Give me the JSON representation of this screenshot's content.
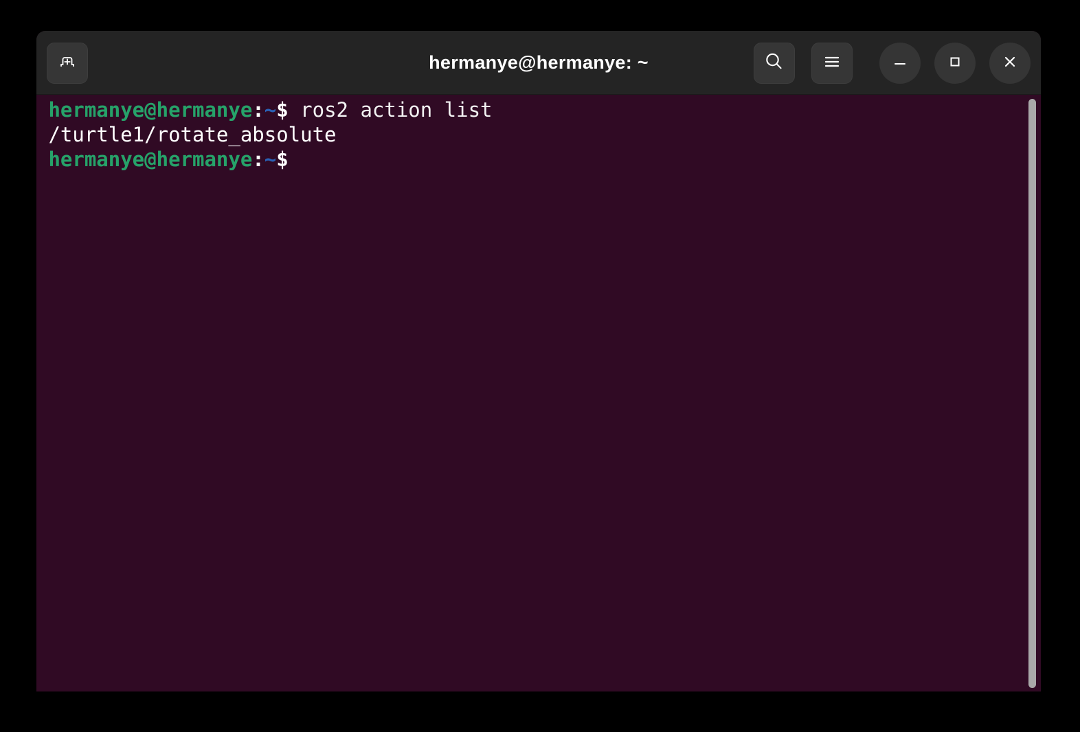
{
  "window": {
    "title": "hermanye@hermanye: ~",
    "colors": {
      "titlebar_bg": "#242424",
      "terminal_bg": "#300a24",
      "button_bg": "#353535",
      "prompt_green": "#26a269",
      "prompt_blue": "#2a61b5",
      "text_white": "#ffffff",
      "scrollbar": "#a9a9a9",
      "desktop_bg": "#000000"
    }
  },
  "titlebar": {
    "new_tab": {
      "icon": "new-tab-icon",
      "label": "New Tab"
    },
    "search": {
      "icon": "search-icon",
      "label": "Search"
    },
    "menu": {
      "icon": "hamburger-menu-icon",
      "label": "Main Menu"
    },
    "minimize": {
      "icon": "minimize-icon",
      "label": "Minimize"
    },
    "maximize": {
      "icon": "maximize-icon",
      "label": "Maximize"
    },
    "close": {
      "icon": "close-icon",
      "label": "Close"
    }
  },
  "terminal": {
    "prompt": {
      "userhost": "hermanye@hermanye",
      "colon": ":",
      "cwd": "~",
      "sigil": "$"
    },
    "lines": [
      {
        "type": "prompt",
        "userhost": "hermanye@hermanye",
        "colon": ":",
        "cwd": "~",
        "sigil": "$",
        "command": " ros2 action list"
      },
      {
        "type": "output",
        "text": "/turtle1/rotate_absolute"
      },
      {
        "type": "prompt",
        "userhost": "hermanye@hermanye",
        "colon": ":",
        "cwd": "~",
        "sigil": "$",
        "command": ""
      }
    ],
    "scrollbar": {
      "position_percent": 100
    }
  }
}
